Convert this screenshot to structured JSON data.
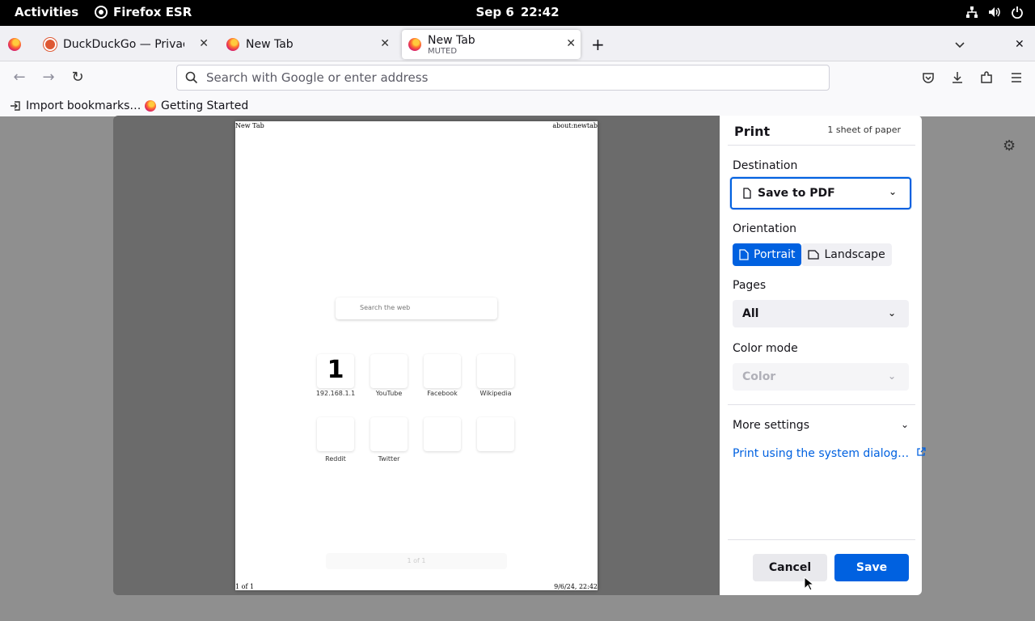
{
  "topbar": {
    "activities": "Activities",
    "app_name": "Firefox ESR",
    "date": "Sep 6",
    "time": "22:42"
  },
  "tabs": [
    {
      "title": "DuckDuckGo — Privacy, s",
      "favicon": "duckduckgo-icon"
    },
    {
      "title": "New Tab",
      "favicon": "firefox-icon"
    },
    {
      "title": "New Tab",
      "subtitle": "MUTED",
      "favicon": "firefox-icon",
      "active": true
    }
  ],
  "urlbar": {
    "placeholder": "Search with Google or enter address"
  },
  "bookmarks": [
    {
      "label": "Import bookmarks…",
      "icon": "import-icon"
    },
    {
      "label": "Getting Started",
      "icon": "firefox-icon"
    }
  ],
  "preview": {
    "header_left": "New Tab",
    "header_right": "about:newtab",
    "footer_left": "1 of 1",
    "footer_right": "9/6/24, 22:42",
    "search_placeholder": "Search the web",
    "tiles": [
      {
        "label": "192.168.1.1",
        "glyph": "1"
      },
      {
        "label": "YouTube"
      },
      {
        "label": "Facebook"
      },
      {
        "label": "Wikipedia"
      },
      {
        "label": "Reddit"
      },
      {
        "label": "Twitter"
      },
      {
        "label": ""
      },
      {
        "label": ""
      }
    ],
    "ghost_nav": "1 of 1"
  },
  "print": {
    "title": "Print",
    "sheet_count": "1 sheet of paper",
    "destination_label": "Destination",
    "destination_value": "Save to PDF",
    "orientation_label": "Orientation",
    "portrait": "Portrait",
    "landscape": "Landscape",
    "pages_label": "Pages",
    "pages_value": "All",
    "color_label": "Color mode",
    "color_value": "Color",
    "more_settings": "More settings",
    "system_dialog": "Print using the system dialog…",
    "cancel": "Cancel",
    "save": "Save"
  },
  "colors": {
    "accent": "#0061e0",
    "topbar": "#000000"
  }
}
